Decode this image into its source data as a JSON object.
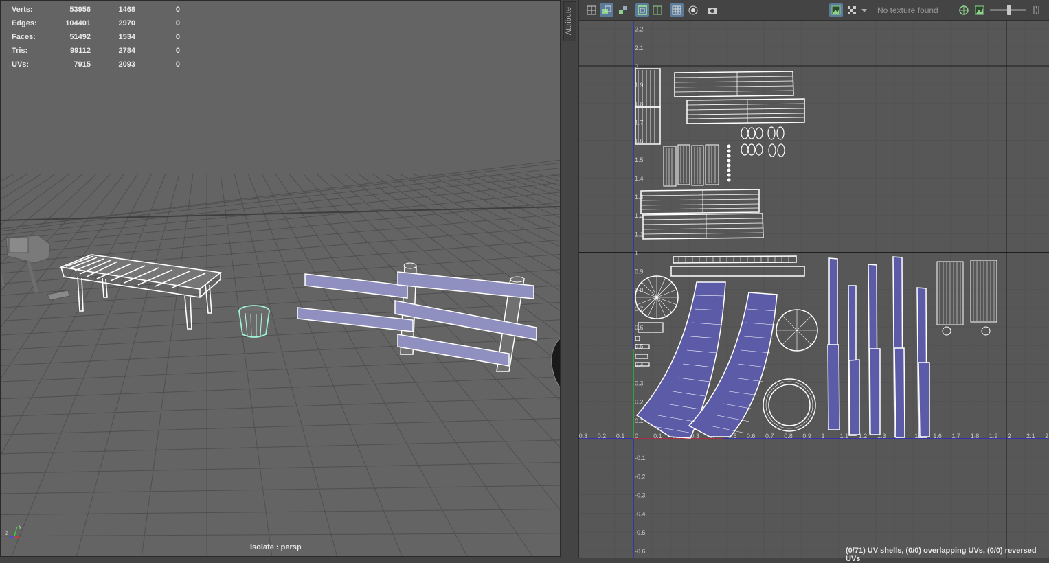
{
  "stats": {
    "rows": [
      {
        "label": "Verts:",
        "total": "53956",
        "selected": "1468",
        "extra": "0"
      },
      {
        "label": "Edges:",
        "total": "104401",
        "selected": "2970",
        "extra": "0"
      },
      {
        "label": "Faces:",
        "total": "51492",
        "selected": "1534",
        "extra": "0"
      },
      {
        "label": "Tris:",
        "total": "99112",
        "selected": "2784",
        "extra": "0"
      },
      {
        "label": "UVs:",
        "total": "7915",
        "selected": "2093",
        "extra": "0"
      }
    ]
  },
  "viewport": {
    "camera_label": "Isolate : persp",
    "gizmo": {
      "y": "y",
      "z": "z"
    }
  },
  "side_tab": {
    "label": "Attribute"
  },
  "uv_toolbar": {
    "texture_field": "No texture found",
    "icons": [
      "layout-single-icon",
      "layout-split-icon",
      "shaded-uv-icon",
      "uv-shell-border-icon",
      "distortion-icon",
      "grid-icon",
      "pixel-snap-icon",
      "snapshot-icon",
      "display-image-icon",
      "checker-icon",
      "dropdown-arrow-icon",
      "exposure-icon",
      "image-range-icon",
      "brightness-slider",
      "gamma-icon"
    ]
  },
  "uv_editor": {
    "status": "(0/71) UV shells, (0/0) overlapping UVs, (0/0) reversed UVs",
    "u_ticks": [
      "0.3",
      "0.2",
      "0.1",
      "0",
      "0.1",
      "0.2",
      "0.3",
      "0.4",
      "0.5",
      "0.6",
      "0.7",
      "0.8",
      "0.9",
      "1",
      "1.1",
      "1.2",
      "1.3",
      "1.4",
      "1.5",
      "1.6",
      "1.7",
      "1.8",
      "1.9",
      "2",
      "2.1",
      "2"
    ],
    "v_ticks_upper": [
      "2.2",
      "2.1",
      "2",
      "1.9",
      "1.8",
      "1.7",
      "1.6",
      "1.5",
      "1.4",
      "1.3",
      "1.2",
      "1.1",
      "1"
    ],
    "v_ticks_lower": [
      "0.9",
      "0.8",
      "0.7",
      "0.6",
      "0.5",
      "0.4",
      "0.3",
      "0.2",
      "0.1",
      "-0.1",
      "-0.2",
      "-0.3",
      "-0.4",
      "-0.5",
      "-0.6"
    ],
    "colors": {
      "shell_fill": "#5b5ba8",
      "u_axis": "#2828c8",
      "v_axis_pos": "#28c828",
      "u_axis_pos": "#c82828"
    }
  }
}
